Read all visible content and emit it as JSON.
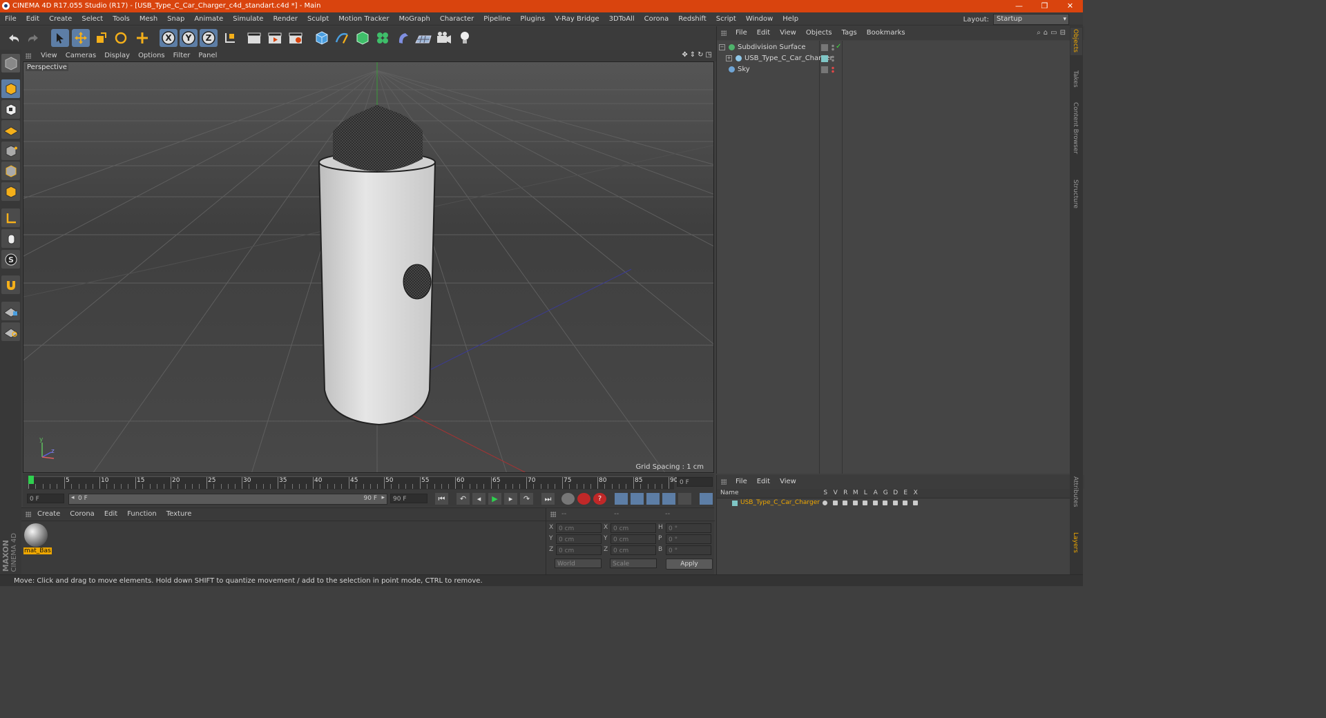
{
  "title": "CINEMA 4D R17.055 Studio (R17) - [USB_Type_C_Car_Charger_c4d_standart.c4d *] - Main",
  "window_buttons": {
    "minimize": "—",
    "restore": "❐",
    "close": "✕"
  },
  "menu": [
    "File",
    "Edit",
    "Create",
    "Select",
    "Tools",
    "Mesh",
    "Snap",
    "Animate",
    "Simulate",
    "Render",
    "Sculpt",
    "Motion Tracker",
    "MoGraph",
    "Character",
    "Pipeline",
    "Plugins",
    "V-Ray Bridge",
    "3DToAll",
    "Corona",
    "Redshift",
    "Script",
    "Window",
    "Help"
  ],
  "layout": {
    "label": "Layout:",
    "value": "Startup"
  },
  "toolbar_axes": [
    "X",
    "Y",
    "Z"
  ],
  "viewport": {
    "menu": [
      "View",
      "Cameras",
      "Display",
      "Options",
      "Filter",
      "Panel"
    ],
    "label": "Perspective",
    "grid_spacing": "Grid Spacing : 1 cm",
    "axis_y": "y",
    "axis_z": "z"
  },
  "timeline": {
    "ticks": [
      "0",
      "5",
      "10",
      "15",
      "20",
      "25",
      "30",
      "35",
      "40",
      "45",
      "50",
      "55",
      "60",
      "65",
      "70",
      "75",
      "80",
      "85",
      "90"
    ],
    "frame_end_field": "0 F"
  },
  "anim": {
    "start": "0 F",
    "range_start": "0 F",
    "range_end": "90 F",
    "end": "90 F"
  },
  "materials": {
    "menu": [
      "Create",
      "Corona",
      "Edit",
      "Function",
      "Texture"
    ],
    "items": [
      {
        "name": "mat_Bas"
      }
    ]
  },
  "coords": {
    "headers": [
      "--",
      "--",
      "--"
    ],
    "rows": [
      {
        "a": "X",
        "a_val": "0 cm",
        "b": "X",
        "b_val": "0 cm",
        "c": "H",
        "c_val": "0 °"
      },
      {
        "a": "Y",
        "a_val": "0 cm",
        "b": "Y",
        "b_val": "0 cm",
        "c": "P",
        "c_val": "0 °"
      },
      {
        "a": "Z",
        "a_val": "0 cm",
        "b": "Z",
        "b_val": "0 cm",
        "c": "B",
        "c_val": "0 °"
      }
    ],
    "world": "World",
    "scale": "Scale",
    "apply": "Apply"
  },
  "object_manager": {
    "menu": [
      "File",
      "Edit",
      "View",
      "Objects",
      "Tags",
      "Bookmarks"
    ],
    "objects": [
      {
        "name": "Subdivision Surface",
        "color": "#4fb36b"
      },
      {
        "name": "USB_Type_C_Car_Charger",
        "color": "#8fc7e8"
      },
      {
        "name": "Sky",
        "color": "#6fa5d6"
      }
    ]
  },
  "layer_manager": {
    "menu": [
      "File",
      "Edit",
      "View"
    ],
    "columns": {
      "name": "Name",
      "flags": [
        "S",
        "V",
        "R",
        "M",
        "L",
        "A",
        "G",
        "D",
        "E",
        "X"
      ]
    },
    "rows": [
      {
        "name": "USB_Type_C_Car_Charger",
        "color": "#7fc6c6"
      }
    ]
  },
  "side_tabs": [
    "Objects",
    "Takes",
    "Content Browser",
    "Structure"
  ],
  "side_tabs_bottom": [
    "Attributes",
    "Layers"
  ],
  "brand": {
    "maxon": "MAXON",
    "c4d": "CINEMA 4D"
  },
  "status": "Move: Click and drag to move elements. Hold down SHIFT to quantize movement / add to the selection in point mode, CTRL to remove.",
  "colors": {
    "title_bar": "#d9440e",
    "selection": "#5d7ea6",
    "object_highlight": "#f0a800"
  }
}
